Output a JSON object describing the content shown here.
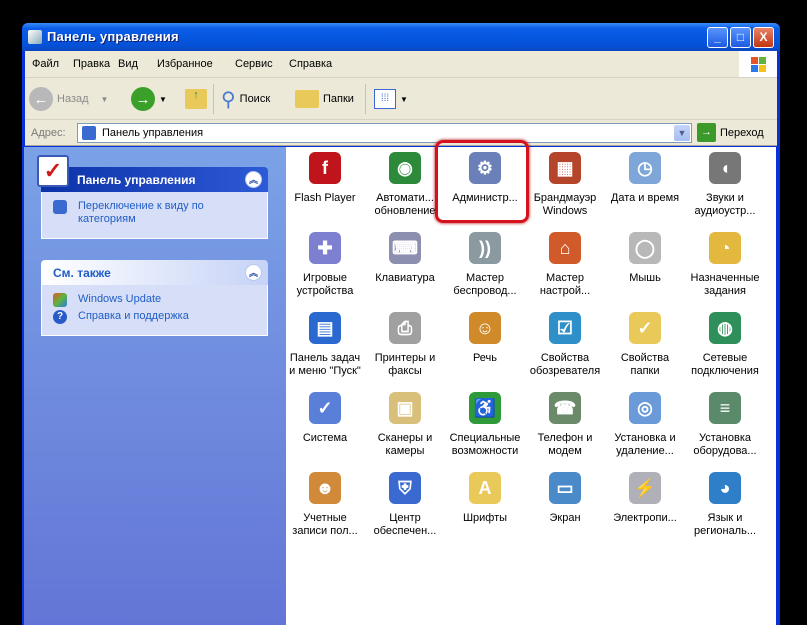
{
  "window": {
    "title": "Панель управления",
    "min": "_",
    "max": "□",
    "close": "X"
  },
  "menu": [
    "Файл",
    "Правка",
    "Вид",
    "Избранное",
    "Сервис",
    "Справка"
  ],
  "toolbar": {
    "back": "Назад",
    "search": "Поиск",
    "folders": "Папки"
  },
  "address": {
    "label": "Адрес:",
    "value": "Панель управления",
    "go": "Переход"
  },
  "sidebar": {
    "panel_title": "Панель управления",
    "switch_view": "Переключение к виду по категориям",
    "see_also_title": "См. также",
    "see_also": [
      "Windows Update",
      "Справка и поддержка"
    ]
  },
  "colors": {
    "titlebar": "#0554DC",
    "sidebar": "#7BA2E7",
    "highlight": "#D4121E",
    "link": "#215DC6"
  },
  "items": [
    {
      "label": "Flash Player",
      "icon": "flash-icon",
      "color": "#c0141c",
      "glyph": "f"
    },
    {
      "label": "Автомати... обновление",
      "icon": "automatic-updates-icon",
      "color": "#2d8a3a",
      "glyph": "◉"
    },
    {
      "label": "Администр...",
      "icon": "administrative-tools-icon",
      "color": "#6b7fb8",
      "glyph": "⚙",
      "highlighted": true
    },
    {
      "label": "Брандмауэр Windows",
      "icon": "firewall-icon",
      "color": "#b5452a",
      "glyph": "▦"
    },
    {
      "label": "Дата и время",
      "icon": "date-time-icon",
      "color": "#7fa6d8",
      "glyph": "◷"
    },
    {
      "label": "Звуки и аудиоустр...",
      "icon": "sound-icon",
      "color": "#777",
      "glyph": "◖"
    },
    {
      "label": "Игровые устройства",
      "icon": "game-controller-icon",
      "color": "#7d80d0",
      "glyph": "✚"
    },
    {
      "label": "Клавиатура",
      "icon": "keyboard-icon",
      "color": "#8c8fb0",
      "glyph": "⌨"
    },
    {
      "label": "Мастер беспровод...",
      "icon": "wireless-wizard-icon",
      "color": "#8a9aa0",
      "glyph": "))"
    },
    {
      "label": "Мастер настрой...",
      "icon": "network-wizard-icon",
      "color": "#d05a2a",
      "glyph": "⌂"
    },
    {
      "label": "Мышь",
      "icon": "mouse-icon",
      "color": "#b8b8b8",
      "glyph": "◯"
    },
    {
      "label": "Назначенные задания",
      "icon": "scheduled-tasks-icon",
      "color": "#e3b83f",
      "glyph": "◔"
    },
    {
      "label": "Панель задач и меню \"Пуск\"",
      "icon": "taskbar-icon",
      "color": "#2a6ad0",
      "glyph": "▤"
    },
    {
      "label": "Принтеры и факсы",
      "icon": "printer-icon",
      "color": "#a0a0a0",
      "glyph": "⎙"
    },
    {
      "label": "Речь",
      "icon": "speech-icon",
      "color": "#d08a2a",
      "glyph": "☺"
    },
    {
      "label": "Свойства обозревателя",
      "icon": "internet-options-icon",
      "color": "#2f8fc8",
      "glyph": "☑"
    },
    {
      "label": "Свойства папки",
      "icon": "folder-options-icon",
      "color": "#e8c95a",
      "glyph": "✓"
    },
    {
      "label": "Сетевые подключения",
      "icon": "network-connections-icon",
      "color": "#2f8f5a",
      "glyph": "◍"
    },
    {
      "label": "Система",
      "icon": "system-icon",
      "color": "#5a7fd8",
      "glyph": "✓"
    },
    {
      "label": "Сканеры и камеры",
      "icon": "scanner-icon",
      "color": "#d8c07a",
      "glyph": "▣"
    },
    {
      "label": "Специальные возможности",
      "icon": "accessibility-icon",
      "color": "#2e9a3a",
      "glyph": "♿"
    },
    {
      "label": "Телефон и модем",
      "icon": "phone-modem-icon",
      "color": "#6a8a6a",
      "glyph": "☎"
    },
    {
      "label": "Установка и удаление...",
      "icon": "add-remove-programs-icon",
      "color": "#6a9ad8",
      "glyph": "◎"
    },
    {
      "label": "Установка оборудова...",
      "icon": "add-hardware-icon",
      "color": "#5a8a6a",
      "glyph": "≡"
    },
    {
      "label": "Учетные записи пол...",
      "icon": "user-accounts-icon",
      "color": "#d08a3a",
      "glyph": "☻"
    },
    {
      "label": "Центр обеспечен...",
      "icon": "security-center-icon",
      "color": "#3a6ad0",
      "glyph": "⛨"
    },
    {
      "label": "Шрифты",
      "icon": "fonts-icon",
      "color": "#e8c95a",
      "glyph": "A"
    },
    {
      "label": "Экран",
      "icon": "display-icon",
      "color": "#4a8ac8",
      "glyph": "▭"
    },
    {
      "label": "Электропи...",
      "icon": "power-options-icon",
      "color": "#b0b0b8",
      "glyph": "⚡"
    },
    {
      "label": "Язык и региональ...",
      "icon": "regional-options-icon",
      "color": "#2f7fc8",
      "glyph": "◕"
    }
  ]
}
